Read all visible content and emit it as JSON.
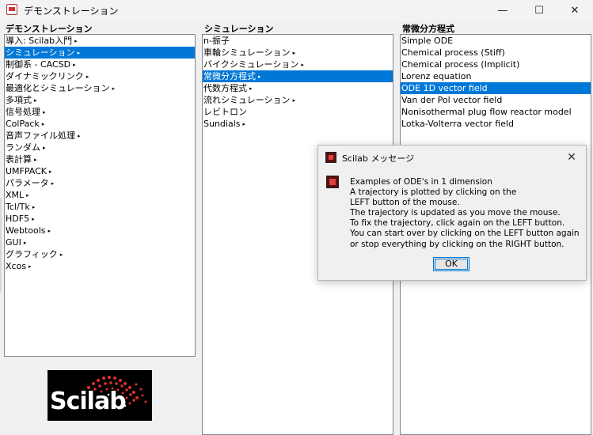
{
  "window": {
    "title": "デモンストレーション",
    "minimize": "—",
    "maximize": "☐",
    "close": "✕"
  },
  "columns": {
    "col1": {
      "header": "デモンストレーション",
      "items": [
        {
          "label": "導入: Scilab入門",
          "arrow": "▸",
          "selected": false
        },
        {
          "label": "シミュレーション",
          "arrow": "▸",
          "selected": true
        },
        {
          "label": "制御系 - CACSD",
          "arrow": "▸",
          "selected": false
        },
        {
          "label": "ダイナミックリンク",
          "arrow": "▸",
          "selected": false
        },
        {
          "label": "最適化とシミュレーション",
          "arrow": "▸",
          "selected": false
        },
        {
          "label": "多項式",
          "arrow": "▸",
          "selected": false
        },
        {
          "label": "信号処理",
          "arrow": "▸",
          "selected": false
        },
        {
          "label": "ColPack",
          "arrow": "▸",
          "selected": false
        },
        {
          "label": "音声ファイル処理",
          "arrow": "▸",
          "selected": false
        },
        {
          "label": "ランダム",
          "arrow": "▸",
          "selected": false
        },
        {
          "label": "表計算",
          "arrow": "▸",
          "selected": false
        },
        {
          "label": "UMFPACK",
          "arrow": "▸",
          "selected": false
        },
        {
          "label": "パラメータ",
          "arrow": "▸",
          "selected": false
        },
        {
          "label": "XML",
          "arrow": "▸",
          "selected": false
        },
        {
          "label": "Tcl/Tk",
          "arrow": "▸",
          "selected": false
        },
        {
          "label": "HDF5",
          "arrow": "▸",
          "selected": false
        },
        {
          "label": "Webtools",
          "arrow": "▸",
          "selected": false
        },
        {
          "label": "GUI",
          "arrow": "▸",
          "selected": false
        },
        {
          "label": "グラフィック",
          "arrow": "▸",
          "selected": false
        },
        {
          "label": "Xcos",
          "arrow": "▸",
          "selected": false
        }
      ]
    },
    "col2": {
      "header": "シミュレーション",
      "items": [
        {
          "label": "n-振子",
          "arrow": "",
          "selected": false
        },
        {
          "label": "車輪シミュレーション",
          "arrow": "▸",
          "selected": false
        },
        {
          "label": "バイクシミュレーション",
          "arrow": "▸",
          "selected": false
        },
        {
          "label": "常微分方程式",
          "arrow": "▸",
          "selected": true
        },
        {
          "label": "代数方程式",
          "arrow": "▸",
          "selected": false
        },
        {
          "label": "流れシミュレーション",
          "arrow": "▸",
          "selected": false
        },
        {
          "label": "レビトロン",
          "arrow": "",
          "selected": false
        },
        {
          "label": "Sundials",
          "arrow": "▸",
          "selected": false
        }
      ]
    },
    "col3": {
      "header": "常微分方程式",
      "items": [
        {
          "label": "Simple ODE",
          "arrow": "",
          "selected": false
        },
        {
          "label": "Chemical process (Stiff)",
          "arrow": "",
          "selected": false
        },
        {
          "label": "Chemical process (Implicit)",
          "arrow": "",
          "selected": false
        },
        {
          "label": "Lorenz equation",
          "arrow": "",
          "selected": false
        },
        {
          "label": "ODE 1D vector field",
          "arrow": "",
          "selected": true
        },
        {
          "label": "Van der Pol vector field",
          "arrow": "",
          "selected": false
        },
        {
          "label": "Nonisothermal plug flow reactor model",
          "arrow": "",
          "selected": false
        },
        {
          "label": "Lotka-Volterra vector field",
          "arrow": "",
          "selected": false
        }
      ]
    }
  },
  "logo": {
    "text": "Scilab"
  },
  "dialog": {
    "title": "Scilab メッセージ",
    "close": "✕",
    "lines": [
      "Examples of ODE's in 1 dimension",
      "A trajectory is plotted by clicking on the",
      "LEFT button of the mouse.",
      "The trajectory is updated as you move the mouse.",
      "To fix the trajectory, click again on the LEFT button.",
      "You can start over by clicking on the LEFT button again",
      "or stop everything by clicking on the RIGHT button."
    ],
    "ok_label": "OK"
  }
}
